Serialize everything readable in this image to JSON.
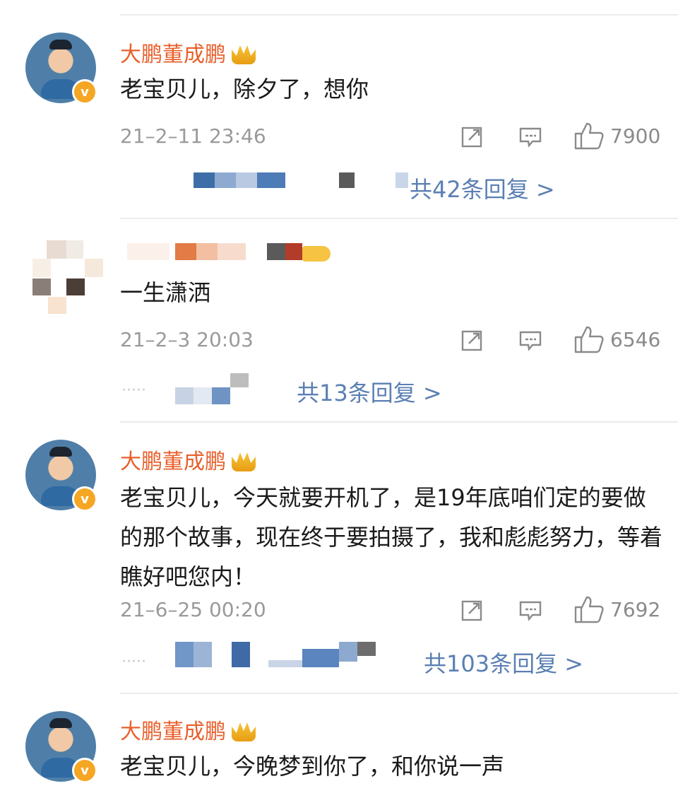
{
  "comments": [
    {
      "username": "大鹏董成鹏",
      "text": "老宝贝儿，除夕了，想你",
      "time": "21–2–11 23:46",
      "likes": "7900",
      "replies": "共42条回复 >"
    },
    {
      "username": "",
      "text": "一生潇洒",
      "time": "21–2–3 20:03",
      "likes": "6546",
      "replies": "共13条回复 >"
    },
    {
      "username": "大鹏董成鹏",
      "text": "老宝贝儿，今天就要开机了，是19年底咱们定的要做的那个故事，现在终于要拍摄了，我和彪彪努力，等着瞧好吧您内！",
      "time": "21–6–25 00:20",
      "likes": "7692",
      "replies": "共103条回复 >"
    },
    {
      "username": "大鹏董成鹏",
      "text": "老宝贝儿，今晚梦到你了，和你说一声",
      "time": "",
      "likes": "",
      "replies": ""
    }
  ],
  "dots": "·····",
  "icons": {
    "verified": "v-badge-icon",
    "crown": "crown-icon",
    "share": "share-icon",
    "comment": "comment-icon",
    "like": "thumbs-up-icon"
  },
  "colors": {
    "username": "#e8602c",
    "reply_link": "#5b7fb3",
    "meta": "#9a9a9a"
  }
}
